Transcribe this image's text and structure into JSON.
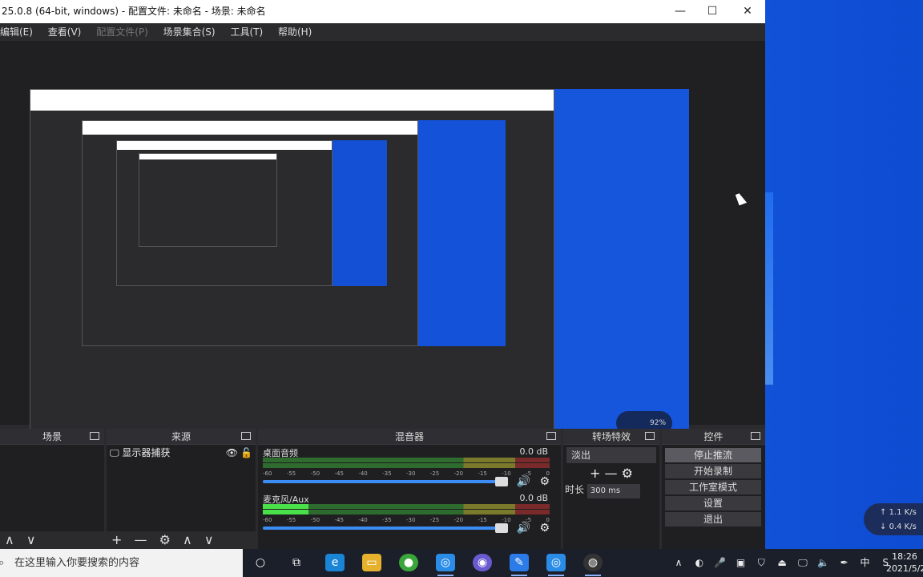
{
  "window": {
    "title": "25.0.8 (64-bit, windows) - 配置文件: 未命名 - 场景: 未命名",
    "controls": {
      "minimize": "—",
      "maximize": "☐",
      "close": "✕"
    }
  },
  "menu": [
    {
      "label": "编辑(E)",
      "disabled": false
    },
    {
      "label": "查看(V)",
      "disabled": false
    },
    {
      "label": "配置文件(P)",
      "disabled": true
    },
    {
      "label": "场景集合(S)",
      "disabled": false
    },
    {
      "label": "工具(T)",
      "disabled": false
    },
    {
      "label": "帮助(H)",
      "disabled": false
    }
  ],
  "docks": {
    "scenes": {
      "title": "场景",
      "footer": [
        "∧",
        "∨"
      ]
    },
    "sources": {
      "title": "来源",
      "items": [
        {
          "label": "显示器捕获",
          "icon": "monitor-icon",
          "visible": true,
          "locked": false
        }
      ],
      "footer": [
        "+",
        "—",
        "⚙",
        "∧",
        "∨"
      ]
    },
    "mixer": {
      "title": "混音器",
      "scale": [
        "-60",
        "-55",
        "-50",
        "-45",
        "-40",
        "-35",
        "-30",
        "-25",
        "-20",
        "-15",
        "-10",
        "-5",
        "0"
      ],
      "tracks": [
        {
          "name": "桌面音频",
          "db": "0.0 dB",
          "level": 0.0
        },
        {
          "name": "麦克风/Aux",
          "db": "0.0 dB",
          "level": 0.16
        }
      ]
    },
    "transitions": {
      "title": "转场特效",
      "selected": "淡出",
      "duration_label": "时长",
      "duration_value": "300 ms",
      "buttons": [
        "+",
        "—",
        "⚙"
      ]
    },
    "controls": {
      "title": "控件",
      "buttons": [
        "停止推流",
        "开始录制",
        "工作室模式",
        "设置",
        "退出"
      ]
    }
  },
  "taskbar": {
    "search_placeholder": "在这里输入你要搜索的内容",
    "time": "18:26",
    "date": "2021/5/2",
    "ime": "中",
    "net_up": "1.1",
    "net_down": "0.4",
    "net_unit": "K/s"
  },
  "preview_mini": {
    "cpu": "92"
  }
}
